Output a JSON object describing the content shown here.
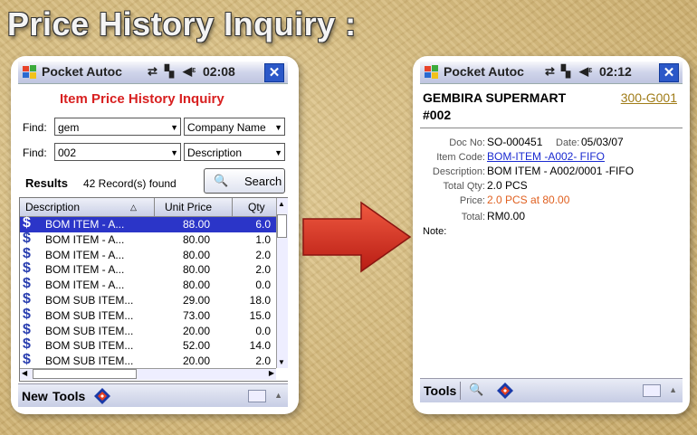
{
  "page_title": "Price History Inquiry :",
  "left_device": {
    "titlebar": {
      "app": "Pocket Autoc",
      "time": "02:08",
      "close": "✕"
    },
    "heading": "Item Price History Inquiry",
    "find1": {
      "label": "Find:",
      "value": "gem",
      "field_option": "Company Name"
    },
    "find2": {
      "label": "Find:",
      "value": "002",
      "field_option": "Description"
    },
    "results": {
      "label": "Results",
      "count": "42 Record(s) found",
      "search_button": "Search"
    },
    "columns": [
      "Description",
      "Unit Price",
      "Qty"
    ],
    "rows": [
      {
        "desc": "BOM  ITEM - A...",
        "price": "88.00",
        "qty": "6.0",
        "selected": true
      },
      {
        "desc": "BOM  ITEM - A...",
        "price": "80.00",
        "qty": "1.0"
      },
      {
        "desc": "BOM  ITEM - A...",
        "price": "80.00",
        "qty": "2.0"
      },
      {
        "desc": "BOM  ITEM - A...",
        "price": "80.00",
        "qty": "2.0"
      },
      {
        "desc": "BOM  ITEM - A...",
        "price": "80.00",
        "qty": "0.0"
      },
      {
        "desc": "BOM  SUB ITEM...",
        "price": "29.00",
        "qty": "18.0"
      },
      {
        "desc": "BOM  SUB ITEM...",
        "price": "73.00",
        "qty": "15.0"
      },
      {
        "desc": "BOM  SUB ITEM...",
        "price": "20.00",
        "qty": "0.0"
      },
      {
        "desc": "BOM  SUB ITEM...",
        "price": "52.00",
        "qty": "14.0"
      },
      {
        "desc": "BOM  SUB ITEM...",
        "price": "20.00",
        "qty": "2.0"
      }
    ],
    "menubar": {
      "new": "New",
      "tools": "Tools"
    }
  },
  "right_device": {
    "titlebar": {
      "app": "Pocket Autoc",
      "time": "02:12",
      "close": "✕"
    },
    "company": "GEMBIRA SUPERMART",
    "company_line2": "#002",
    "account_code": "300-G001",
    "doc_no_label": "Doc No:",
    "doc_no": "SO-000451",
    "date_label": "Date:",
    "date": "05/03/07",
    "item_code_label": "Item Code:",
    "item_code": "BOM-ITEM -A002- FIFO",
    "description_label": "Description:",
    "description": "BOM ITEM - A002/0001 -FIFO",
    "total_qty_label": "Total Qty:",
    "total_qty": "2.0 PCS",
    "price_label": "Price:",
    "price": "2.0 PCS at 80.00",
    "total_label": "Total:",
    "total": "RM0.00",
    "note_label": "Note:",
    "menubar": {
      "tools": "Tools"
    }
  },
  "colors": {
    "arrow": "#d42a20",
    "selected_row": "#2b35c8",
    "heading": "#d82020",
    "link": "#1a2ad0",
    "price_text": "#e06020"
  }
}
